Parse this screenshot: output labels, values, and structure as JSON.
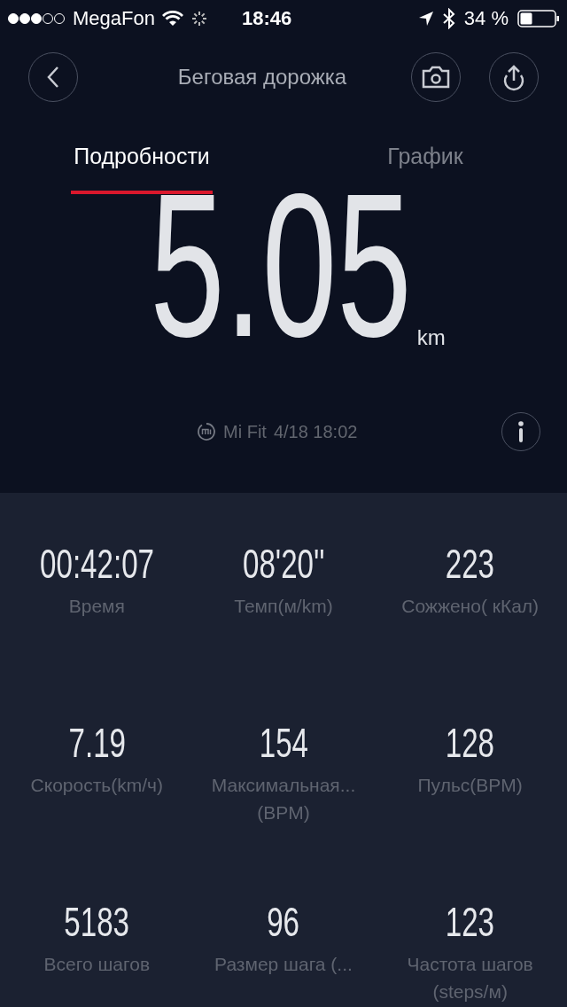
{
  "status_bar": {
    "carrier": "MegaFon",
    "time": "18:46",
    "battery": "34 %"
  },
  "header": {
    "title": "Беговая дорожка"
  },
  "tabs": [
    {
      "label": "Подробности",
      "selected": true
    },
    {
      "label": "График",
      "selected": false
    }
  ],
  "distance": {
    "value": "5.05",
    "unit": "km"
  },
  "source": {
    "app": "Mi Fit",
    "datetime": "4/18 18:02"
  },
  "stats": [
    {
      "value": "00:42:07",
      "label": "Время"
    },
    {
      "value": "08'20''",
      "label": "Темп(м/km)"
    },
    {
      "value": "223",
      "label": "Сожжено( кКал)"
    },
    {
      "value": "7.19",
      "label": "Скорость(km/ч)"
    },
    {
      "value": "154",
      "label": "Максимальная... (BPM)"
    },
    {
      "value": "128",
      "label": "Пульс(BPM)"
    },
    {
      "value": "5183",
      "label": "Всего шагов"
    },
    {
      "value": "96",
      "label": "Размер шага (..."
    },
    {
      "value": "123",
      "label": "Частота шагов (steps/м)"
    }
  ]
}
